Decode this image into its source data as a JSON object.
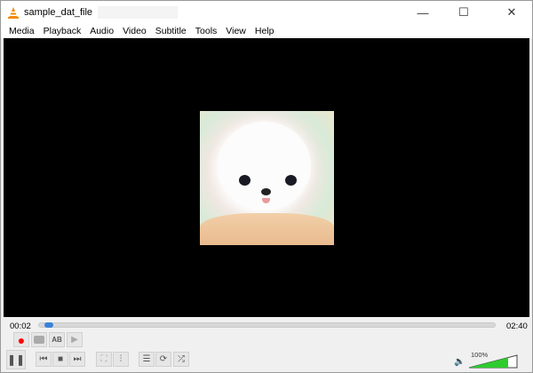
{
  "window": {
    "title": "sample_dat_file",
    "minimize": "—",
    "maximize": "☐",
    "close": "✕"
  },
  "menu": [
    "Media",
    "Playback",
    "Audio",
    "Video",
    "Subtitle",
    "Tools",
    "View",
    "Help"
  ],
  "player": {
    "elapsed": "00:02",
    "duration": "02:40",
    "progress": 0.0125,
    "volume": "100%",
    "volume_level": 1.0,
    "accent": "#3a82d8",
    "record_color": "#ff0000",
    "volume_color": "#2ecc2e"
  },
  "icons": {
    "record": "●",
    "snapshot": "📷",
    "ab_loop": "AB",
    "frame": "▶",
    "pause": "❚❚",
    "prev": "⏮",
    "stop": "■",
    "next": "⏭",
    "fullscreen": "⛶",
    "ext": "⫶",
    "playlist": "☰",
    "loop": "⟳",
    "shuffle": "⤮",
    "speaker": "🔈"
  }
}
